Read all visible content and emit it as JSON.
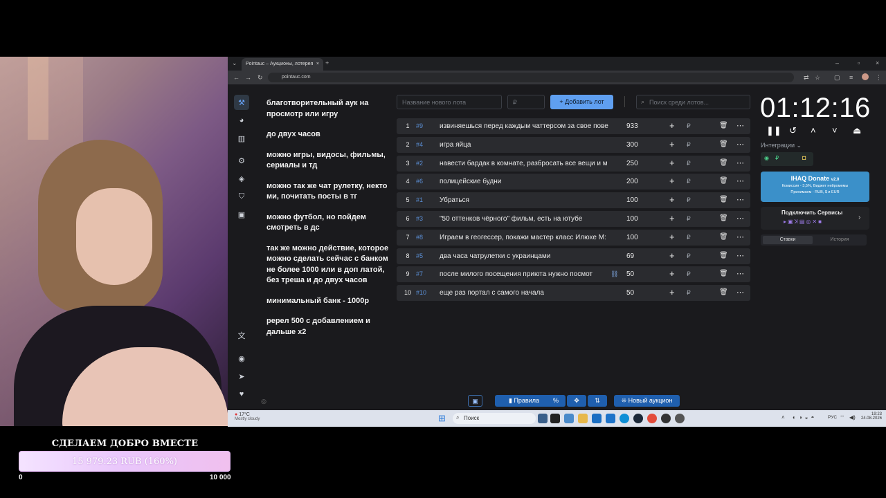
{
  "donation": {
    "title": "СДЕЛАЕМ ДОБРО ВМЕСТЕ",
    "amount": "15 979.23 RUB (160%)",
    "min": "0",
    "max": "10 000"
  },
  "browser": {
    "tab_title": "Pointauc – Аукционы, лотерея",
    "url": "pointauc.com"
  },
  "rules": [
    "благотворительный аук на просмотр или игру",
    "до  двух часов",
    "можно игры, видосы, фильмы, сериалы и тд",
    "можно так же чат рулетку, некто ми, почитать посты в тг",
    "можно футбол, но пойдем смотреть в дс",
    "так же можно действие, которое можно сделать сейчас с банком не более 1000 или в доп латой, без треша  и до двух часов",
    "минимальный банк - 1000р",
    "ререл 500 с добавлением и дальше х2"
  ],
  "controls": {
    "lot_name_placeholder": "Название нового лота",
    "amount_placeholder": "₽",
    "add_lot": "Добавить лот",
    "search_placeholder": "Поиск среди лотов..."
  },
  "lots": [
    {
      "n": "1",
      "id": "#9",
      "name": "извиняешься перед каждым чаттерсом за свое пове",
      "amount": "933"
    },
    {
      "n": "2",
      "id": "#4",
      "name": "игра яйца",
      "amount": "300"
    },
    {
      "n": "3",
      "id": "#2",
      "name": "навести бардак в комнате, разбросать все вещи и м",
      "amount": "250"
    },
    {
      "n": "4",
      "id": "#6",
      "name": "полицейские будни",
      "amount": "200"
    },
    {
      "n": "5",
      "id": "#1",
      "name": "Убраться",
      "amount": "100"
    },
    {
      "n": "6",
      "id": "#3",
      "name": "\"50 оттенков чёрного\" фильм, есть на ютубе",
      "amount": "100"
    },
    {
      "n": "7",
      "id": "#8",
      "name": "Играем в геогессер, покажи мастер класс Илюхе М:",
      "amount": "100"
    },
    {
      "n": "8",
      "id": "#5",
      "name": "два часа чатрулетки с украинцами",
      "amount": "69"
    },
    {
      "n": "9",
      "id": "#7",
      "name": "после милого посещения приюта нужно посмот",
      "amount": "50"
    },
    {
      "n": "10",
      "id": "#10",
      "name": "еще раз портал с самого начала",
      "amount": "50"
    }
  ],
  "lot_currency": "₽",
  "timer": "01:12:16",
  "integrations": {
    "label": "Интеграции",
    "ihaq_title": "IHAQ Donate",
    "ihaq_version": "v2.0",
    "ihaq_line1": "Комиссия - 3,5%, Виджет нейромемы",
    "ihaq_line2": "Принимаем - RUB, $ и EUR",
    "connect_label": "Подключить Сервисы",
    "tab_bets": "Ставки",
    "tab_history": "История"
  },
  "bottom": {
    "rules_btn": "Правила",
    "percent_btn": "%",
    "new_auction": "Новый аукцион"
  },
  "taskbar": {
    "weather_temp": "17°C",
    "weather_desc": "Mostly cloudy",
    "search": "Поиск",
    "lang": "РУС",
    "time": "19:23",
    "date": "24.08.2026"
  }
}
